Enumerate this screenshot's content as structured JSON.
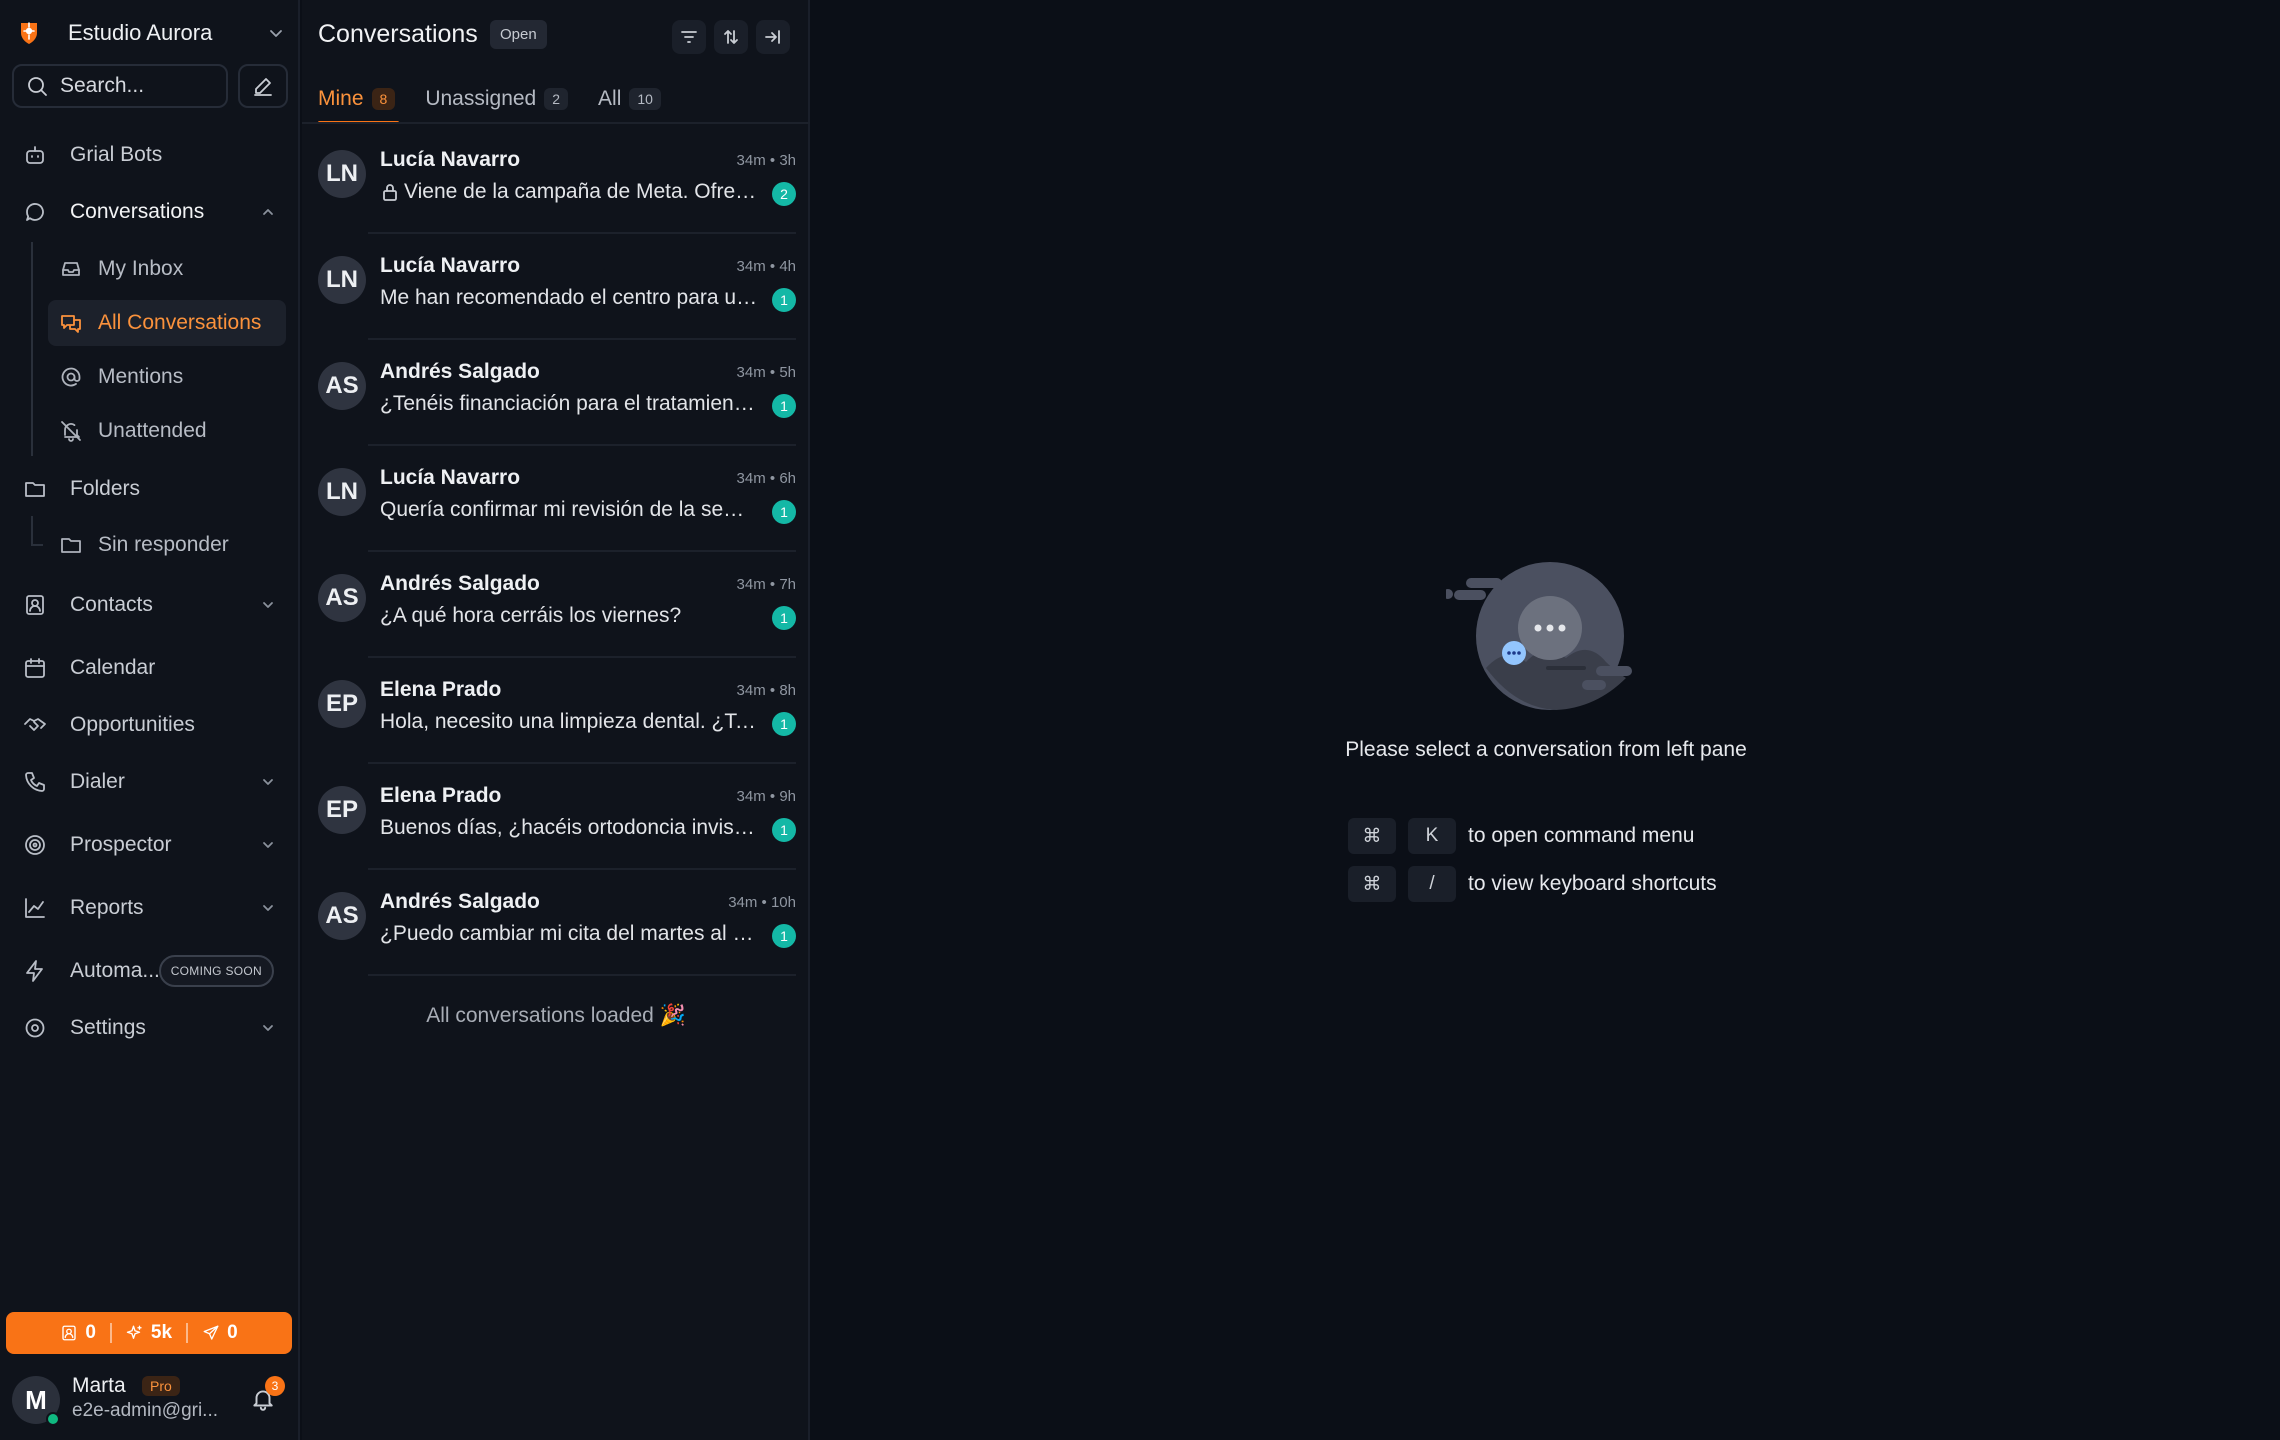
{
  "sidebar": {
    "workspace": "Estudio Aurora",
    "search_placeholder": "Search...",
    "nav": {
      "bots": "Grial Bots",
      "conversations": "Conversations",
      "my_inbox": "My Inbox",
      "all_conversations": "All Conversations",
      "mentions": "Mentions",
      "unattended": "Unattended",
      "folders": "Folders",
      "sin_responder": "Sin responder",
      "contacts": "Contacts",
      "calendar": "Calendar",
      "opportunities": "Opportunities",
      "dialer": "Dialer",
      "prospector": "Prospector",
      "reports": "Reports",
      "automations": "Automa...",
      "coming_soon": "COMING SOON",
      "settings": "Settings"
    },
    "credits": {
      "contacts": "0",
      "ai": "5k",
      "sent": "0"
    },
    "user": {
      "name": "Marta",
      "plan": "Pro",
      "email": "e2e-admin@gri...",
      "initial": "M",
      "notifications": "3"
    }
  },
  "list": {
    "title": "Conversations",
    "status": "Open",
    "tabs": [
      {
        "label": "Mine",
        "count": "8"
      },
      {
        "label": "Unassigned",
        "count": "2"
      },
      {
        "label": "All",
        "count": "10"
      }
    ],
    "conversations": [
      {
        "initials": "LN",
        "name": "Lucía Navarro",
        "time": "34m • 3h",
        "message": "Viene de la campaña de Meta. Ofrecer primera consulta gratis.",
        "unread": "2",
        "private": true
      },
      {
        "initials": "LN",
        "name": "Lucía Navarro",
        "time": "34m • 4h",
        "message": "Me han recomendado el centro para una valoración",
        "unread": "1",
        "private": false
      },
      {
        "initials": "AS",
        "name": "Andrés Salgado",
        "time": "34m • 5h",
        "message": "¿Tenéis financiación para el tratamiento?",
        "unread": "1",
        "private": false
      },
      {
        "initials": "LN",
        "name": "Lucía Navarro",
        "time": "34m • 6h",
        "message": "Quería confirmar mi revisión de la semana que viene",
        "unread": "1",
        "private": false
      },
      {
        "initials": "AS",
        "name": "Andrés Salgado",
        "time": "34m • 7h",
        "message": "¿A qué hora cerráis los viernes?",
        "unread": "1",
        "private": false
      },
      {
        "initials": "EP",
        "name": "Elena Prado",
        "time": "34m • 8h",
        "message": "Hola, necesito una limpieza dental. ¿Tenéis hueco?",
        "unread": "1",
        "private": false
      },
      {
        "initials": "EP",
        "name": "Elena Prado",
        "time": "34m • 9h",
        "message": "Buenos días, ¿hacéis ortodoncia invisible?",
        "unread": "1",
        "private": false
      },
      {
        "initials": "AS",
        "name": "Andrés Salgado",
        "time": "34m • 10h",
        "message": "¿Puedo cambiar mi cita del martes al jueves?",
        "unread": "1",
        "private": false
      }
    ],
    "footer": "All conversations loaded 🎉"
  },
  "main": {
    "empty_text": "Please select a conversation from left pane",
    "shortcuts": [
      {
        "keys": [
          "⌘",
          "K"
        ],
        "text": "to open command menu"
      },
      {
        "keys": [
          "⌘",
          "/"
        ],
        "text": "to view keyboard shortcuts"
      }
    ]
  },
  "colors": {
    "accent": "#f97316",
    "unread": "#14b8a6",
    "bg": "#0b0f17",
    "panel": "#0f131b"
  }
}
